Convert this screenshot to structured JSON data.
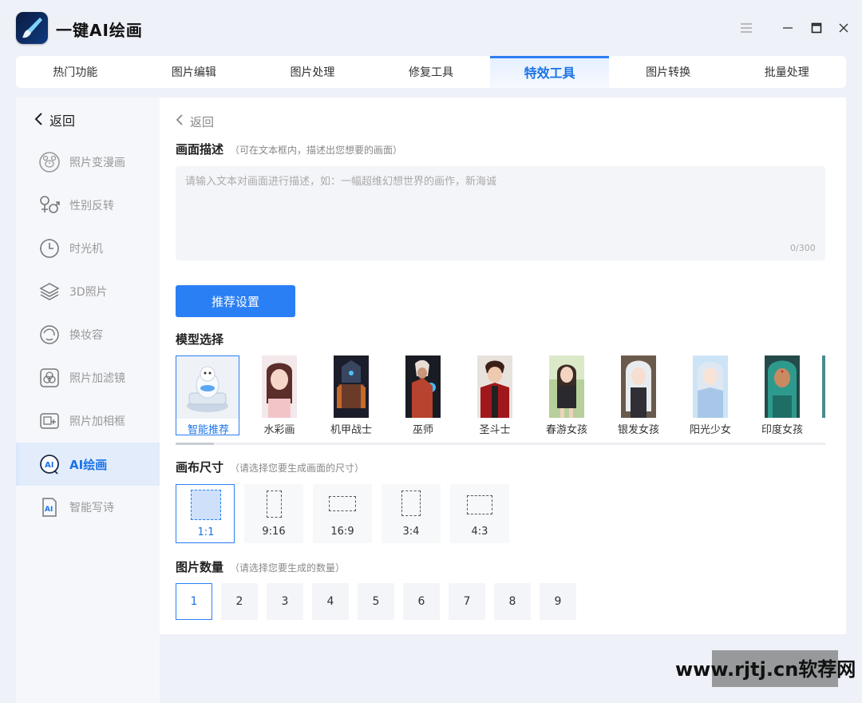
{
  "app": {
    "title": "一键AI绘画"
  },
  "tabs": [
    {
      "label": "热门功能"
    },
    {
      "label": "图片编辑"
    },
    {
      "label": "图片处理"
    },
    {
      "label": "修复工具"
    },
    {
      "label": "特效工具",
      "active": true
    },
    {
      "label": "图片转换"
    },
    {
      "label": "批量处理"
    }
  ],
  "sidebar": {
    "back_label": "返回",
    "items": [
      {
        "label": "照片变漫画",
        "icon": "bear-face-icon"
      },
      {
        "label": "性别反转",
        "icon": "gender-icon"
      },
      {
        "label": "时光机",
        "icon": "clock-icon"
      },
      {
        "label": "3D照片",
        "icon": "layers-icon"
      },
      {
        "label": "换妆容",
        "icon": "makeup-icon"
      },
      {
        "label": "照片加滤镜",
        "icon": "filter-icon"
      },
      {
        "label": "照片加相框",
        "icon": "frame-icon"
      },
      {
        "label": "AI绘画",
        "icon": "ai-paint-icon",
        "active": true
      },
      {
        "label": "智能写诗",
        "icon": "ai-doc-icon"
      }
    ]
  },
  "main": {
    "back_label": "返回",
    "desc": {
      "title": "画面描述",
      "hint": "（可在文本框内，描述出您想要的画面）",
      "placeholder": "请输入文本对画面进行描述，如：一幅超维幻想世界的画作，新海诚",
      "counter": "0/300"
    },
    "recommend_button": "推荐设置",
    "models": {
      "title": "模型选择",
      "items": [
        {
          "label": "智能推荐",
          "active": true
        },
        {
          "label": "水彩画"
        },
        {
          "label": "机甲战士"
        },
        {
          "label": "巫师"
        },
        {
          "label": "圣斗士"
        },
        {
          "label": "春游女孩"
        },
        {
          "label": "银发女孩"
        },
        {
          "label": "阳光少女"
        },
        {
          "label": "印度女孩"
        }
      ]
    },
    "canvas": {
      "title": "画布尺寸",
      "hint": "（请选择您要生成画面的尺寸）",
      "options": [
        "1:1",
        "9:16",
        "16:9",
        "3:4",
        "4:3"
      ],
      "selected": "1:1"
    },
    "count": {
      "title": "图片数量",
      "hint": "（请选择您要生成的数量）",
      "options": [
        "1",
        "2",
        "3",
        "4",
        "5",
        "6",
        "7",
        "8",
        "9"
      ],
      "selected": "1"
    }
  },
  "watermark": "www.rjtj.cn软荐网",
  "colors": {
    "accent": "#2a7ff5",
    "active_text": "#1a73e8",
    "sidebar_bg": "#f6f7fb"
  }
}
